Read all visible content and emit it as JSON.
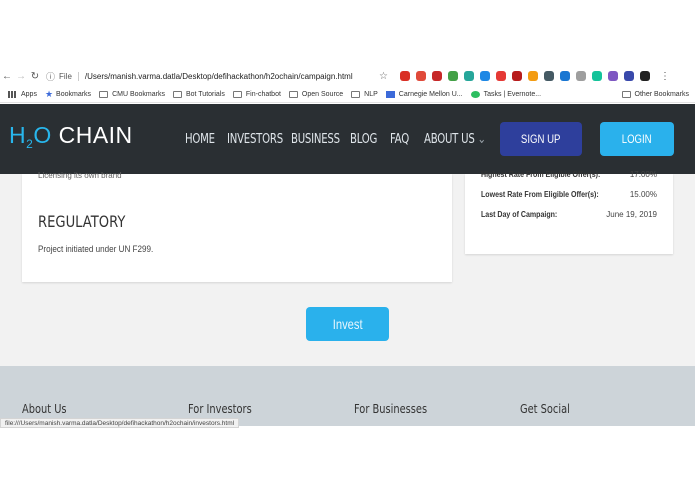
{
  "browser": {
    "file_label": "File",
    "url": "/Users/manish.varma.datla/Desktop/defihackathon/h2ochain/campaign.html",
    "bookmarks": [
      "Apps",
      "Bookmarks",
      "CMU Bookmarks",
      "Bot Tutorials",
      "Fin-chatbot",
      "Open Source",
      "NLP",
      "Carnegie Mellon U...",
      "Tasks | Evernote..."
    ],
    "other_bookmarks": "Other Bookmarks",
    "status_url": "file:///Users/manish.varma.datla/Desktop/defihackathon/h2ochain/investors.html"
  },
  "header": {
    "logo_h": "H",
    "logo_2": "2",
    "logo_o": "O",
    "logo_chain": "CHAIN",
    "nav": [
      "HOME",
      "INVESTORS",
      "BUSINESS",
      "BLOG",
      "FAQ",
      "ABOUT US"
    ],
    "signup": "SIGN UP",
    "login": "LOGIN"
  },
  "main": {
    "cut_text": "Licensing its own brand",
    "regulatory_heading": "REGULATORY",
    "regulatory_text": "Project initiated under UN F299.",
    "stats": [
      {
        "label": "Highest Rate From Eligible Offer(s):",
        "value": "17.00%"
      },
      {
        "label": "Lowest Rate From Eligible Offer(s):",
        "value": "15.00%"
      },
      {
        "label": "Last Day of Campaign:",
        "value": "June 19, 2019"
      }
    ],
    "invest_label": "Invest"
  },
  "footer": {
    "columns": [
      "About Us",
      "For Investors",
      "For Businesses",
      "Get Social"
    ]
  },
  "colors": {
    "accent": "#2ab1ec",
    "signup": "#2e3f9c",
    "header_bg": "#2a2f33"
  }
}
